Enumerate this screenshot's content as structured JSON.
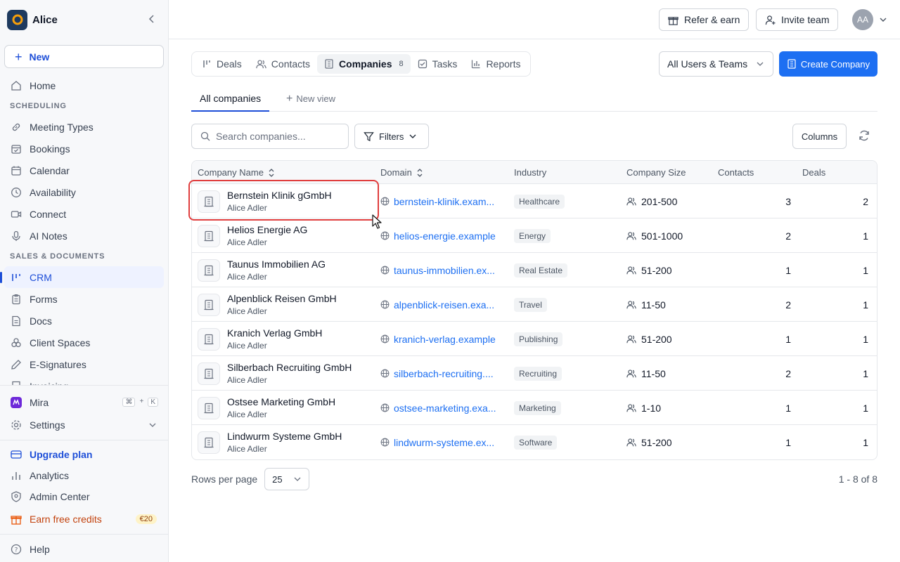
{
  "sidebar": {
    "workspace": "Alice",
    "new_label": "New",
    "nav": [
      {
        "type": "item",
        "label": "Home",
        "icon": "home-icon"
      },
      {
        "type": "section",
        "label": "SCHEDULING"
      },
      {
        "type": "item",
        "label": "Meeting Types",
        "icon": "link-icon"
      },
      {
        "type": "item",
        "label": "Bookings",
        "icon": "calendar-check-icon"
      },
      {
        "type": "item",
        "label": "Calendar",
        "icon": "calendar-icon"
      },
      {
        "type": "item",
        "label": "Availability",
        "icon": "clock-icon"
      },
      {
        "type": "item",
        "label": "Connect",
        "icon": "video-icon"
      },
      {
        "type": "item",
        "label": "AI Notes",
        "icon": "microphone-icon"
      },
      {
        "type": "section",
        "label": "SALES & DOCUMENTS"
      },
      {
        "type": "item",
        "label": "CRM",
        "icon": "crm-icon",
        "active": true
      },
      {
        "type": "item",
        "label": "Forms",
        "icon": "clipboard-icon"
      },
      {
        "type": "item",
        "label": "Docs",
        "icon": "document-icon"
      },
      {
        "type": "item",
        "label": "Client Spaces",
        "icon": "spaces-icon"
      },
      {
        "type": "item",
        "label": "E-Signatures",
        "icon": "pen-icon"
      },
      {
        "type": "item",
        "label": "Invoicing",
        "icon": "invoice-icon"
      }
    ],
    "mira": "Mira",
    "mira_shortcut": [
      "⌘",
      "+",
      "K"
    ],
    "settings": "Settings",
    "upgrade": "Upgrade plan",
    "analytics": "Analytics",
    "admin": "Admin Center",
    "earn": "Earn free credits",
    "earn_badge": "€20",
    "help": "Help"
  },
  "topbar": {
    "refer": "Refer & earn",
    "invite": "Invite team",
    "avatar_initials": "AA"
  },
  "tabs": [
    {
      "label": "Deals",
      "icon": "deals-icon"
    },
    {
      "label": "Contacts",
      "icon": "users-icon"
    },
    {
      "label": "Companies",
      "icon": "building-icon",
      "count": "8",
      "active": true
    },
    {
      "label": "Tasks",
      "icon": "checkbox-icon"
    },
    {
      "label": "Reports",
      "icon": "chart-icon"
    }
  ],
  "users_filter": "All Users & Teams",
  "create_company": "Create Company",
  "views": {
    "active": "All companies",
    "new": "New view"
  },
  "search": {
    "placeholder": "Search companies...",
    "value": ""
  },
  "filters_label": "Filters",
  "columns_label": "Columns",
  "table": {
    "columns": [
      "Company Name",
      "Domain",
      "Industry",
      "Company Size",
      "Contacts",
      "Deals"
    ],
    "rows": [
      {
        "name": "Bernstein Klinik gGmbH",
        "owner": "Alice Adler",
        "domain": "bernstein-klinik.exam...",
        "industry": "Healthcare",
        "size": "201-500",
        "contacts": "3",
        "deals": "2"
      },
      {
        "name": "Helios Energie AG",
        "owner": "Alice Adler",
        "domain": "helios-energie.example",
        "industry": "Energy",
        "size": "501-1000",
        "contacts": "2",
        "deals": "1"
      },
      {
        "name": "Taunus Immobilien AG",
        "owner": "Alice Adler",
        "domain": "taunus-immobilien.ex...",
        "industry": "Real Estate",
        "size": "51-200",
        "contacts": "1",
        "deals": "1"
      },
      {
        "name": "Alpenblick Reisen GmbH",
        "owner": "Alice Adler",
        "domain": "alpenblick-reisen.exa...",
        "industry": "Travel",
        "size": "11-50",
        "contacts": "2",
        "deals": "1"
      },
      {
        "name": "Kranich Verlag GmbH",
        "owner": "Alice Adler",
        "domain": "kranich-verlag.example",
        "industry": "Publishing",
        "size": "51-200",
        "contacts": "1",
        "deals": "1"
      },
      {
        "name": "Silberbach Recruiting GmbH",
        "owner": "Alice Adler",
        "domain": "silberbach-recruiting....",
        "industry": "Recruiting",
        "size": "11-50",
        "contacts": "2",
        "deals": "1"
      },
      {
        "name": "Ostsee Marketing GmbH",
        "owner": "Alice Adler",
        "domain": "ostsee-marketing.exa...",
        "industry": "Marketing",
        "size": "1-10",
        "contacts": "1",
        "deals": "1"
      },
      {
        "name": "Lindwurm Systeme GmbH",
        "owner": "Alice Adler",
        "domain": "lindwurm-systeme.ex...",
        "industry": "Software",
        "size": "51-200",
        "contacts": "1",
        "deals": "1"
      }
    ]
  },
  "footer": {
    "rows_label": "Rows per page",
    "rows_value": "25",
    "pagination": "1 - 8 of 8"
  },
  "colors": {
    "accent": "#1d6ff2",
    "highlight": "#e03e3e",
    "active_nav": "#1d4ed8"
  }
}
